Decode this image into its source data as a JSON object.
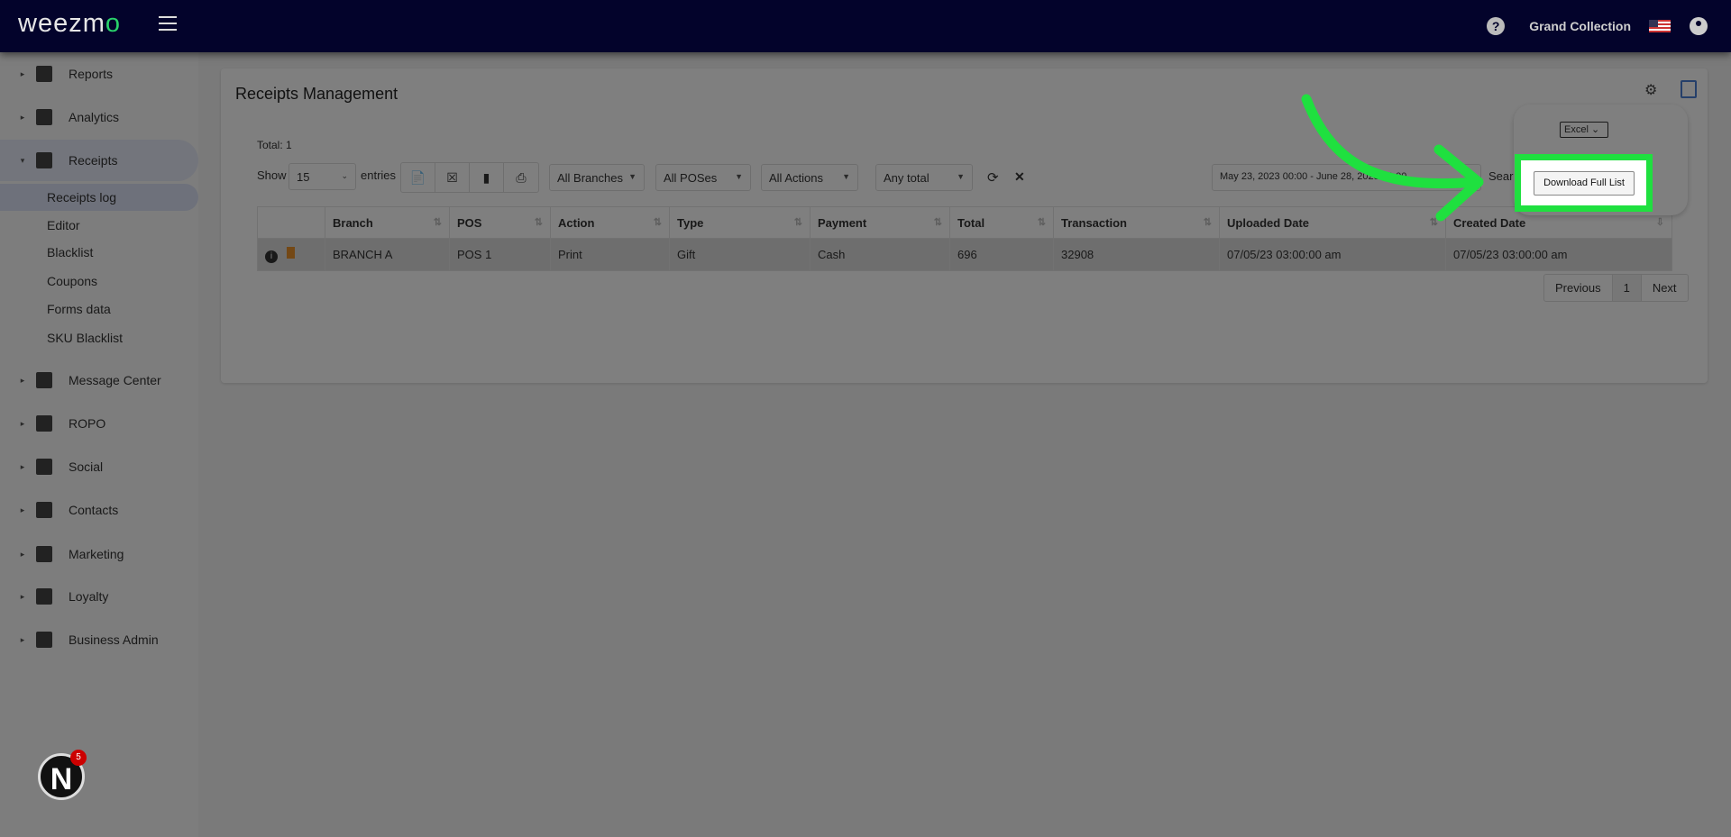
{
  "header": {
    "logo": "weezmo",
    "account": "Grand Collection"
  },
  "sidebar": {
    "items": [
      {
        "label": "Reports",
        "icon": "dashboard-icon"
      },
      {
        "label": "Analytics",
        "icon": "chart-icon"
      },
      {
        "label": "Receipts",
        "icon": "receipt-icon"
      },
      {
        "label": "Message Center",
        "icon": "chat-icon"
      },
      {
        "label": "ROPO",
        "icon": "infinity-icon"
      },
      {
        "label": "Social",
        "icon": "people-icon"
      },
      {
        "label": "Contacts",
        "icon": "contacts-icon"
      },
      {
        "label": "Marketing",
        "icon": "party-icon"
      },
      {
        "label": "Loyalty",
        "icon": "tag-icon"
      },
      {
        "label": "Business Admin",
        "icon": "gear-icon"
      }
    ],
    "sub": [
      "Receipts log",
      "Editor",
      "Blacklist",
      "Coupons",
      "Forms data",
      "SKU Blacklist"
    ]
  },
  "main": {
    "title": "Receipts Management",
    "total": "Total: 1",
    "show": "Show",
    "entries_value": "15",
    "entries": "entries",
    "filters": {
      "branches": "All Branches",
      "poses": "All POSes",
      "actions": "All Actions",
      "total": "Any total"
    },
    "date_range": "May 23, 2023 00:00 - June 28, 2023 00:00",
    "search_label": "Sear",
    "columns": [
      "Branch",
      "POS",
      "Action",
      "Type",
      "Payment",
      "Total",
      "Transaction",
      "Uploaded Date",
      "Created Date"
    ],
    "rows": [
      [
        "BRANCH A",
        "POS 1",
        "Print",
        "Gift",
        "Cash",
        "696",
        "32908",
        "07/05/23 03:00:00 am",
        "07/05/23 03:00:00 am"
      ]
    ],
    "pager": {
      "prev": "Previous",
      "page": "1",
      "next": "Next"
    }
  },
  "popup": {
    "format": "Excel",
    "download": "Download Full List"
  },
  "widget": {
    "letter": "N",
    "badge": "5"
  },
  "colors": {
    "header": "#03032b",
    "highlight": "#1fe03f"
  }
}
